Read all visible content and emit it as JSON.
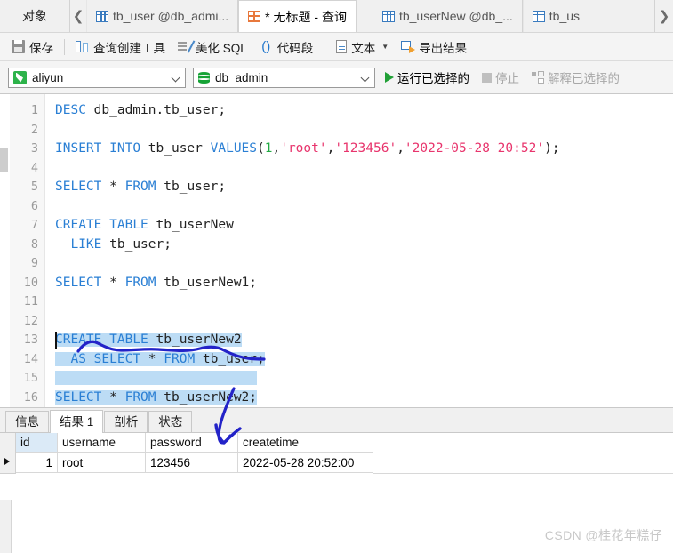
{
  "window": {
    "tabbar": {
      "object_tab": "对象",
      "scroll_left_icon": "chevron-left-icon",
      "scroll_right_icon": "chevron-right-icon",
      "tabs": [
        {
          "label": "tb_user @db_admi...",
          "icon": "table-icon",
          "active": false
        },
        {
          "label": "* 无标题 - 查询",
          "icon": "query-icon",
          "active": true
        },
        {
          "label": "tb_userNew @db_...",
          "icon": "table-icon",
          "active": false
        },
        {
          "label": "tb_us",
          "icon": "table-icon",
          "active": false
        }
      ]
    },
    "toolbar": {
      "items": [
        {
          "label": "保存",
          "icon": "save-icon",
          "caret": false
        },
        {
          "label": "查询创建工具",
          "icon": "query-builder-icon",
          "caret": false
        },
        {
          "label": "美化 SQL",
          "icon": "beautify-icon",
          "caret": false
        },
        {
          "label": "代码段",
          "icon": "code-snippet-icon",
          "caret": false
        },
        {
          "label": "文本",
          "icon": "text-icon",
          "caret": true
        },
        {
          "label": "导出结果",
          "icon": "export-icon",
          "caret": false
        }
      ]
    },
    "connbar": {
      "connection": {
        "value": "aliyun",
        "icon": "aliyun-icon"
      },
      "database": {
        "value": "db_admin",
        "icon": "database-icon"
      },
      "run_selected": "运行已选择的",
      "stop": "停止",
      "explain_selected": "解释已选择的"
    }
  },
  "editor": {
    "line_numbers": [
      "1",
      "2",
      "3",
      "4",
      "5",
      "6",
      "7",
      "8",
      "9",
      "10",
      "11",
      "12",
      "13",
      "14",
      "15",
      "16"
    ],
    "lines": [
      {
        "n": 1,
        "text": "DESC db_admin.tb_user;",
        "selected": false
      },
      {
        "n": 2,
        "text": "",
        "selected": false
      },
      {
        "n": 3,
        "text": "INSERT INTO tb_user VALUES(1,'root','123456','2022-05-28 20:52');",
        "selected": false
      },
      {
        "n": 4,
        "text": "",
        "selected": false
      },
      {
        "n": 5,
        "text": "SELECT * FROM tb_user;",
        "selected": false
      },
      {
        "n": 6,
        "text": "",
        "selected": false
      },
      {
        "n": 7,
        "text": "CREATE TABLE tb_userNew",
        "selected": false
      },
      {
        "n": 8,
        "text": "  LIKE tb_user;",
        "selected": false
      },
      {
        "n": 9,
        "text": "",
        "selected": false
      },
      {
        "n": 10,
        "text": "SELECT * FROM tb_userNew1;",
        "selected": false
      },
      {
        "n": 11,
        "text": "",
        "selected": false
      },
      {
        "n": 12,
        "text": "",
        "selected": false
      },
      {
        "n": 13,
        "text": "CREATE TABLE tb_userNew2",
        "selected": true
      },
      {
        "n": 14,
        "text": "  AS SELECT * FROM tb_user;",
        "selected": true
      },
      {
        "n": 15,
        "text": "",
        "selected": true
      },
      {
        "n": 16,
        "text": "SELECT * FROM tb_userNew2;",
        "selected": true
      }
    ]
  },
  "results": {
    "tabs": [
      {
        "label": "信息",
        "active": false
      },
      {
        "label": "结果 1",
        "active": true
      },
      {
        "label": "剖析",
        "active": false
      },
      {
        "label": "状态",
        "active": false
      }
    ],
    "columns": [
      "id",
      "username",
      "password",
      "createtime"
    ],
    "rows": [
      {
        "id": "1",
        "username": "root",
        "password": "123456",
        "createtime": "2022-05-28 20:52:00"
      }
    ]
  },
  "annotations": {
    "ink_color": "#2323c8",
    "marks": [
      "underline-squiggle-line15",
      "checkmark-below-editor"
    ]
  },
  "watermark": "CSDN @桂花年糕仔",
  "colors": {
    "keyword": "#2a7fd4",
    "string": "#e8356d",
    "number": "#22aa44",
    "selection": "#bcdcf5",
    "accent_green": "#21a037",
    "chrome": "#f0f0f0"
  }
}
